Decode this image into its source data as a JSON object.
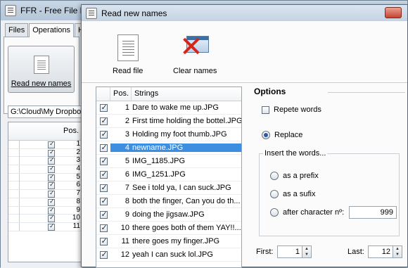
{
  "background_window": {
    "title": "FFR - Free File Re",
    "tabs": [
      "Files",
      "Operations",
      "He"
    ],
    "read_button_label": "Read new names",
    "path": "G:\\Cloud\\My Dropbox\\",
    "table_pos_header": "Pos.",
    "row_numbers": [
      "1",
      "2",
      "3",
      "4",
      "5",
      "6",
      "7",
      "8",
      "9",
      "10",
      "11"
    ]
  },
  "dialog": {
    "title": "Read new names",
    "toolbar": {
      "read_file_label": "Read file",
      "clear_names_label": "Clear names"
    },
    "list": {
      "columns": [
        "",
        "Pos.",
        "Strings"
      ],
      "rows": [
        {
          "pos": "1",
          "text": "Dare to wake me up.JPG",
          "checked": true
        },
        {
          "pos": "2",
          "text": "First time holding the bottel.JPG",
          "checked": true
        },
        {
          "pos": "3",
          "text": "Holding my foot thumb.JPG",
          "checked": true
        },
        {
          "pos": "4",
          "text": "newname.JPG",
          "checked": true,
          "selected": true
        },
        {
          "pos": "5",
          "text": "IMG_1185.JPG",
          "checked": true
        },
        {
          "pos": "6",
          "text": "IMG_1251.JPG",
          "checked": true
        },
        {
          "pos": "7",
          "text": "See i told ya, I can suck.JPG",
          "checked": true
        },
        {
          "pos": "8",
          "text": "both the finger, Can you do th...",
          "checked": true
        },
        {
          "pos": "9",
          "text": "doing the jigsaw.JPG",
          "checked": true
        },
        {
          "pos": "10",
          "text": "there goes both of them YAY!!...",
          "checked": true
        },
        {
          "pos": "11",
          "text": "there goes my finger.JPG",
          "checked": true
        },
        {
          "pos": "12",
          "text": "yeah I can suck lol.JPG",
          "checked": true
        }
      ]
    },
    "options": {
      "title": "Options",
      "repete_words": "Repete words",
      "replace": "Replace",
      "insert_label": "Insert the words...",
      "as_prefix": "as a prefix",
      "as_sufix": "as a sufix",
      "after_char": "after character nº:",
      "after_char_value": "999",
      "first_label": "First:",
      "first_value": "1",
      "last_label": "Last:",
      "last_value": "12"
    }
  },
  "colors": {
    "selection": "#3d8ee0",
    "close_button": "#c7432f"
  }
}
